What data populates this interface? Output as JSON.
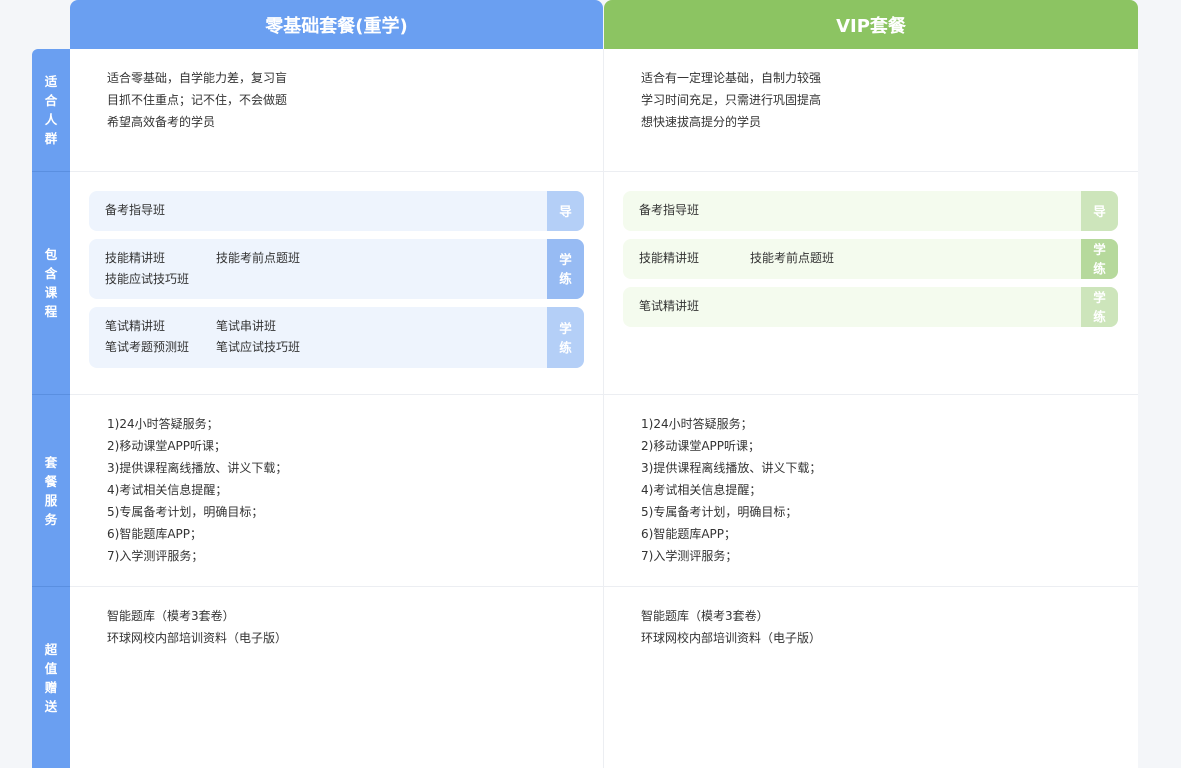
{
  "columns": {
    "zero": {
      "title": "零基础套餐(重学)"
    },
    "vip": {
      "title": "VIP套餐"
    }
  },
  "row_labels": {
    "audience": "适合人群",
    "courses": "包含课程",
    "services": "套餐服务",
    "gifts": "超值赠送"
  },
  "audience": {
    "zero": [
      "适合零基础，自学能力差，复习盲",
      "目抓不住重点；记不住，不会做题",
      "希望高效备考的学员"
    ],
    "vip": [
      "适合有一定理论基础，自制力较强",
      "学习时间充足，只需进行巩固提高",
      "想快速拔高提分的学员"
    ]
  },
  "courses": {
    "zero": [
      {
        "items": [
          "备考指导班"
        ],
        "tag": [
          "导"
        ]
      },
      {
        "items": [
          "技能精讲班",
          "技能考前点题班",
          "技能应试技巧班"
        ],
        "tag": [
          "学",
          "练"
        ]
      },
      {
        "items": [
          "笔试精讲班",
          "笔试串讲班",
          "笔试考题预测班",
          "笔试应试技巧班"
        ],
        "tag": [
          "学",
          "练"
        ]
      }
    ],
    "vip": [
      {
        "items": [
          "备考指导班"
        ],
        "tag": [
          "导"
        ]
      },
      {
        "items": [
          "技能精讲班",
          "技能考前点题班"
        ],
        "tag": [
          "学",
          "练"
        ]
      },
      {
        "items": [
          "笔试精讲班"
        ],
        "tag": [
          "学",
          "练"
        ]
      }
    ]
  },
  "services": {
    "zero": [
      "1)24小时答疑服务；",
      "2)移动课堂APP听课；",
      "3)提供课程离线播放、讲义下载；",
      "4)考试相关信息提醒；",
      "5)专属备考计划，明确目标；",
      "6)智能题库APP；",
      "7)入学测评服务；"
    ],
    "vip": [
      "1)24小时答疑服务；",
      "2)移动课堂APP听课；",
      "3)提供课程离线播放、讲义下载；",
      "4)考试相关信息提醒；",
      "5)专属备考计划，明确目标；",
      "6)智能题库APP；",
      "7)入学测评服务；"
    ]
  },
  "gifts": {
    "zero": [
      "智能题库（模考3套卷）",
      "环球网校内部培训资料（电子版）"
    ],
    "vip": [
      "智能题库（模考3套卷）",
      "环球网校内部培训资料（电子版）"
    ]
  }
}
